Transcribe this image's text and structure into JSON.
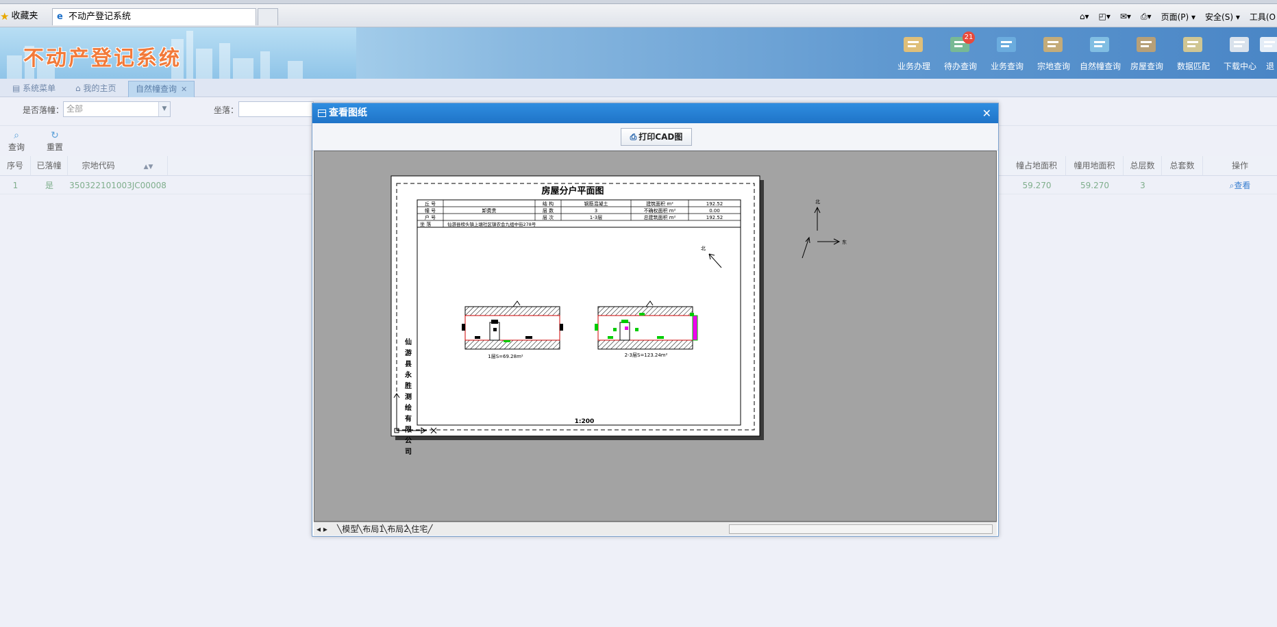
{
  "browser": {
    "favorites_label": "收藏夹",
    "tab_title": "不动产登记系统",
    "commands": [
      "页面(P) ▾",
      "安全(S) ▾",
      "工具(O"
    ]
  },
  "app": {
    "logo": "不动产登记系统",
    "nav": [
      {
        "label": "业务办理",
        "icon": "business-icon",
        "badge": ""
      },
      {
        "label": "待办查询",
        "icon": "todo-icon",
        "badge": "21"
      },
      {
        "label": "业务查询",
        "icon": "business-search-icon",
        "badge": ""
      },
      {
        "label": "宗地查询",
        "icon": "parcel-search-icon",
        "badge": ""
      },
      {
        "label": "自然幢查询",
        "icon": "building-search-icon",
        "badge": ""
      },
      {
        "label": "房屋查询",
        "icon": "house-search-icon",
        "badge": ""
      },
      {
        "label": "数据匹配",
        "icon": "data-match-icon",
        "badge": ""
      },
      {
        "label": "下载中心",
        "icon": "download-icon",
        "badge": ""
      },
      {
        "label": "退",
        "icon": "exit-icon",
        "badge": ""
      }
    ]
  },
  "tabs": [
    {
      "label": "系统菜单",
      "active": false
    },
    {
      "label": "我的主页",
      "active": false
    },
    {
      "label": "自然幢查询",
      "active": true
    }
  ],
  "filter": {
    "label1": "是否落幢：",
    "value1": "全部",
    "label2": "坐落："
  },
  "toolbar": {
    "query": "查询",
    "reset": "重置"
  },
  "grid": {
    "left_headers": [
      "序号",
      "已落幢",
      "宗地代码"
    ],
    "right_headers": [
      "幢占地面积",
      "幢用地面积",
      "总层数",
      "总套数",
      "操作"
    ],
    "row": {
      "index": "1",
      "landed": "是",
      "parcel_code": "350322101003JC00008",
      "occupy_area": "59.270",
      "use_area": "59.270",
      "floors": "3",
      "units": "",
      "action": "查看"
    }
  },
  "modal": {
    "title": "查看图纸",
    "print_button": "打印CAD图",
    "layout_tabs": [
      "模型",
      "布局1",
      "布局2",
      "住宅"
    ]
  },
  "drawing": {
    "title": "房屋分户平面图",
    "table": [
      [
        "丘  号",
        "",
        "结  构",
        "钢筋混凝土",
        "建筑面积 m²",
        "192.52"
      ],
      [
        "幢  号",
        "卸费贵",
        "层  数",
        "3",
        "不确权面积 m²",
        "0.00"
      ],
      [
        "户  号",
        "",
        "层  次",
        "1-3层",
        "总建筑面积 m²",
        "192.52"
      ]
    ],
    "address_label": "坐  落",
    "address": "仙游县榜头镇上塘社区镇农会九组中街278号",
    "plan1_caption": "1层S=69.28m²",
    "plan2_caption": "2-3层S=123.24m²",
    "company": "仙游县永胜测绘有限公司",
    "scale": "1:200",
    "north": "北",
    "east": "东",
    "north_small": "北"
  }
}
